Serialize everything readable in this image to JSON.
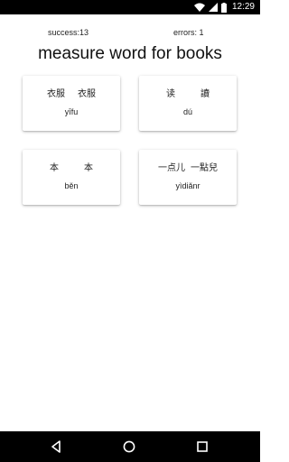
{
  "status_bar": {
    "time": "12:29",
    "icons": [
      "wifi-icon",
      "signal-icon",
      "battery-icon"
    ]
  },
  "score": {
    "success": "success:13",
    "errors": "errors: 1"
  },
  "prompt": "measure word for books",
  "choices": [
    {
      "simplified": "衣服",
      "traditional": "衣服",
      "pinyin": "yīfu"
    },
    {
      "simplified": "读",
      "traditional": "讀",
      "pinyin": "dú"
    },
    {
      "simplified": "本",
      "traditional": "本",
      "pinyin": "běn"
    },
    {
      "simplified": "一点儿",
      "traditional": "一點兒",
      "pinyin": "yìdiǎnr"
    }
  ],
  "nav_bar": {
    "icons": [
      "back-icon",
      "home-icon",
      "recents-icon"
    ]
  }
}
